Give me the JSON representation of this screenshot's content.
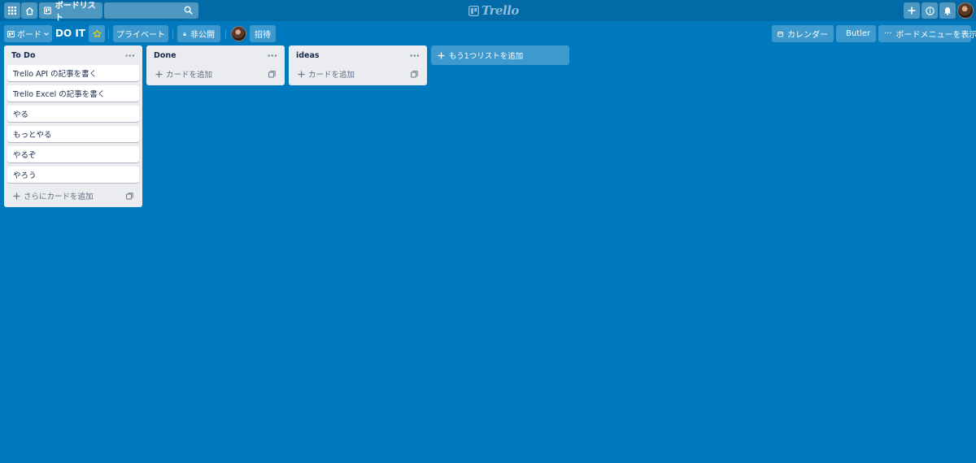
{
  "topbar": {
    "boards_label": "ボードリスト",
    "logo_text": "Trello",
    "search_placeholder": ""
  },
  "board_header": {
    "board_switch_label": "ボード",
    "title": "DO IT",
    "visibility_label": "プライベート",
    "team_label": "非公開",
    "invite_label": "招待",
    "calendar_label": "カレンダー",
    "butler_label": "Butler",
    "menu_label": "ボードメニューを表示"
  },
  "lists": [
    {
      "title": "To Do",
      "cards": [
        "Trello API の記事を書く",
        "Trello Excel の記事を書く",
        "やる",
        "もっとやる",
        "やるぞ",
        "やろう"
      ],
      "add_label": "さらにカードを追加"
    },
    {
      "title": "Done",
      "cards": [],
      "add_label": "カードを追加"
    },
    {
      "title": "ideas",
      "cards": [],
      "add_label": "カードを追加"
    }
  ],
  "add_list_label": "もう1つリストを追加",
  "colors": {
    "board_background": "#0079bf",
    "header_background": "#026aa7",
    "list_background": "#ebecf0"
  }
}
